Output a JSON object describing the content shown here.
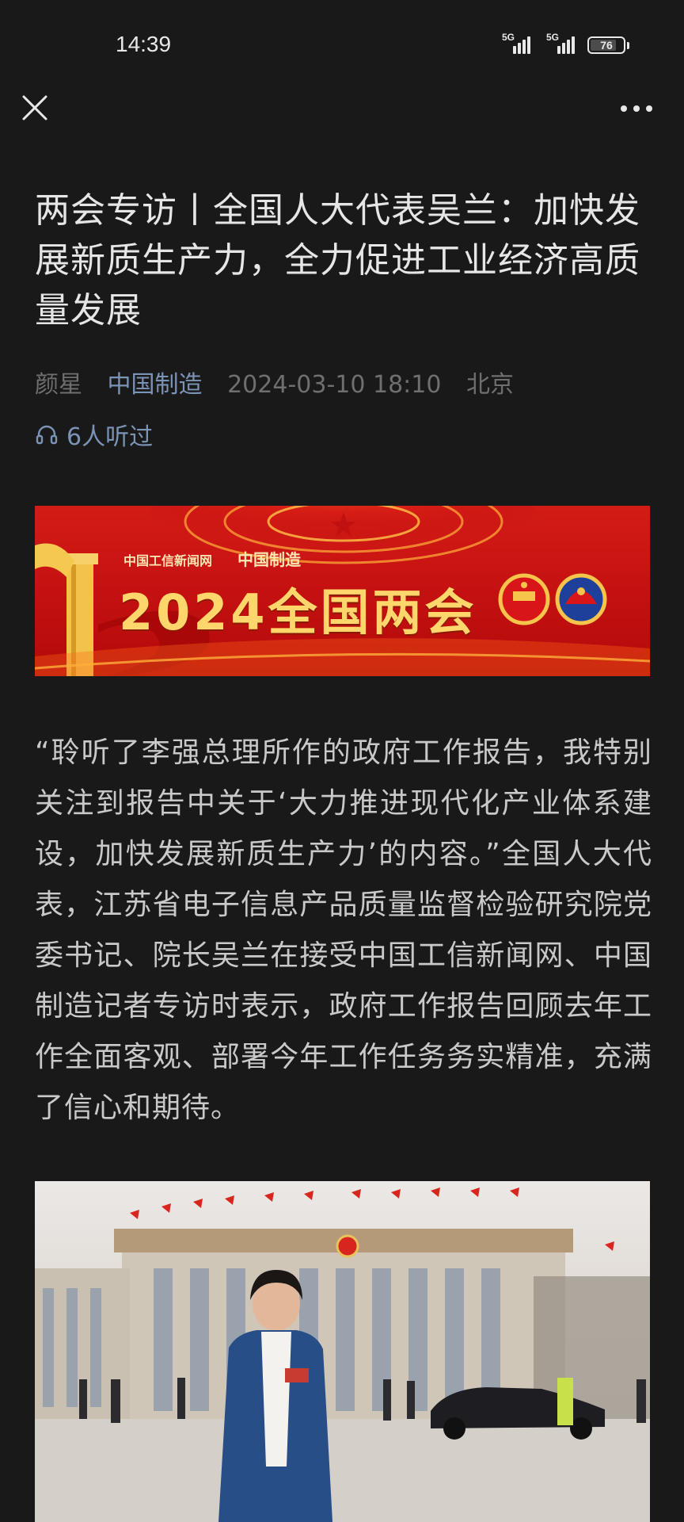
{
  "status_bar": {
    "time": "14:39",
    "network1": "5G",
    "network2": "5G",
    "battery": "76"
  },
  "nav": {
    "close_icon": "close-icon",
    "more_icon": "more-horizontal-icon"
  },
  "article": {
    "title": "两会专访丨全国人大代表吴兰：加快发展新质生产力，全力促进工业经济高质量发展",
    "author": "颜星",
    "source": "中国制造",
    "datetime": "2024-03-10 18:10",
    "location": "北京",
    "listen_count": "6人听过",
    "body": "“聆听了李强总理所作的政府工作报告，我特别关注到报告中关于‘大力推进现代化产业体系建设，加快发展新质生产力’的内容。”全国人大代表，江苏省电子信息产品质量监督检验研究院党委书记、院长吴兰在接受中国工信新闻网、中国制造记者专访时表示，政府工作报告回顾去年工作全面客观、部署今年工作任务务实精准，充满了信心和期待。"
  },
  "banner": {
    "logo_site": "中国工信新闻网",
    "logo_site_url": "cnii.com.cn",
    "logo_brand": "中国制造",
    "headline": "2024全国两会"
  },
  "colors": {
    "background": "#191919",
    "text_primary": "#e6e6e6",
    "text_body": "#c9c9c9",
    "text_meta": "#6f6f6f",
    "link": "#7b94b5",
    "banner_red": "#c31010",
    "banner_gold": "#ffd66b"
  }
}
